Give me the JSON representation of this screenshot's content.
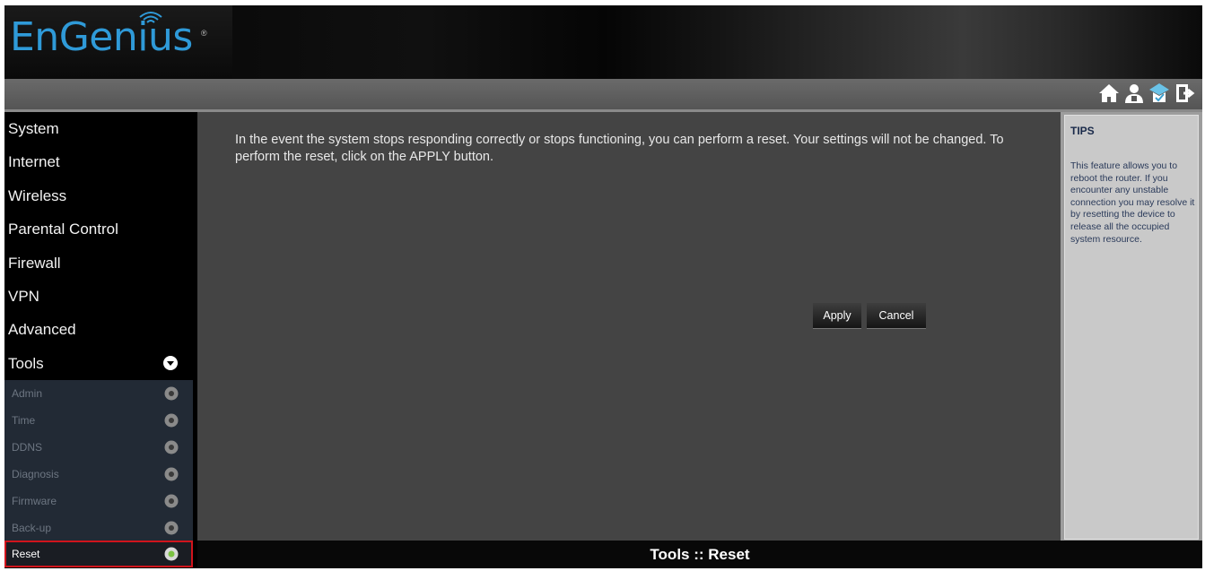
{
  "brand": {
    "logo_text": "EnGenius",
    "logo_mark": "®"
  },
  "toolbar": {
    "icons": [
      "home-icon",
      "user-icon",
      "wizard-icon",
      "logout-icon"
    ]
  },
  "sidebar": {
    "items": [
      {
        "label": "System"
      },
      {
        "label": "Internet"
      },
      {
        "label": "Wireless"
      },
      {
        "label": "Parental Control"
      },
      {
        "label": "Firewall"
      },
      {
        "label": "VPN"
      },
      {
        "label": "Advanced"
      },
      {
        "label": "Tools",
        "expanded": true
      }
    ],
    "subitems": [
      {
        "label": "Admin"
      },
      {
        "label": "Time"
      },
      {
        "label": "DDNS"
      },
      {
        "label": "Diagnosis"
      },
      {
        "label": "Firmware"
      },
      {
        "label": "Back-up"
      },
      {
        "label": "Reset",
        "active": true
      }
    ]
  },
  "main": {
    "description": "In the event the system stops responding correctly or stops functioning, you can perform a reset. Your settings will not be changed. To perform the reset, click on the APPLY button.",
    "apply_label": "Apply",
    "cancel_label": "Cancel"
  },
  "status": {
    "text": "Tools :: Reset"
  },
  "tips": {
    "title": "TIPS",
    "text": "This feature allows you to reboot the router. If you encounter any unstable connection you may resolve it by resetting the device to release all the occupied system resource."
  },
  "colors": {
    "accent": "#2f9ad8",
    "active_outline": "#d0141c",
    "active_dot": "#7bc242"
  }
}
